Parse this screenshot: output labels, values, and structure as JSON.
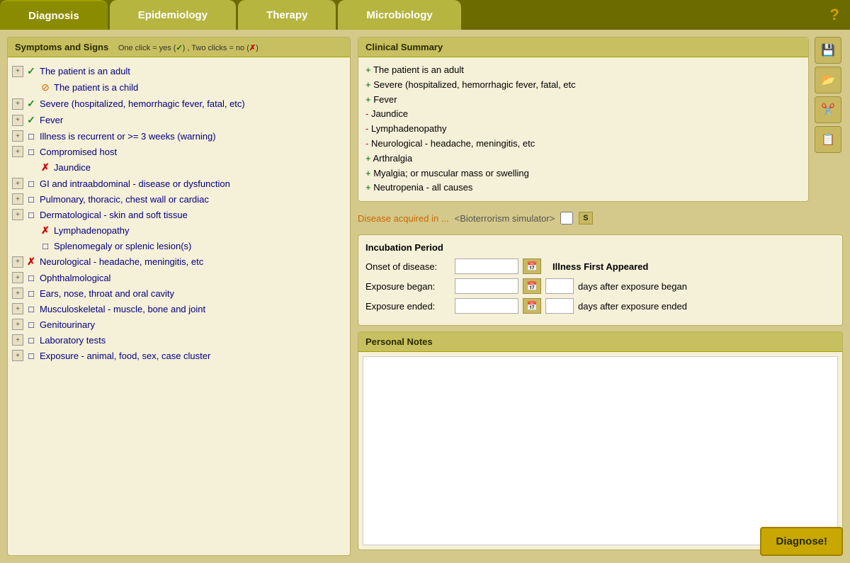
{
  "nav": {
    "tabs": [
      {
        "label": "Diagnosis",
        "active": true
      },
      {
        "label": "Epidemiology",
        "active": false
      },
      {
        "label": "Therapy",
        "active": false
      },
      {
        "label": "Microbiology",
        "active": false
      }
    ],
    "help_icon": "?"
  },
  "left_panel": {
    "header": "Symptoms and Signs",
    "click_hint": "One click = yes (✓) ,  Two clicks = no (✗)",
    "symptoms": [
      {
        "status": "check",
        "label": "The patient is an adult",
        "indent": 0,
        "expandable": true
      },
      {
        "status": "no",
        "label": "The patient is a child",
        "indent": 1,
        "expandable": false
      },
      {
        "status": "check",
        "label": "Severe (hospitalized, hemorrhagic fever, fatal, etc)",
        "indent": 0,
        "expandable": true
      },
      {
        "status": "check",
        "label": "Fever",
        "indent": 0,
        "expandable": true
      },
      {
        "status": "empty",
        "label": "Illness is recurrent or >= 3 weeks (warning)",
        "indent": 0,
        "expandable": true
      },
      {
        "status": "empty",
        "label": "Compromised host",
        "indent": 0,
        "expandable": true
      },
      {
        "status": "cross",
        "label": "Jaundice",
        "indent": 1,
        "expandable": false
      },
      {
        "status": "empty",
        "label": "GI and intraabdominal - disease or dysfunction",
        "indent": 0,
        "expandable": true
      },
      {
        "status": "empty",
        "label": "Pulmonary, thoracic, chest wall or cardiac",
        "indent": 0,
        "expandable": true
      },
      {
        "status": "empty",
        "label": "Dermatological - skin and soft tissue",
        "indent": 0,
        "expandable": true
      },
      {
        "status": "cross",
        "label": "Lymphadenopathy",
        "indent": 1,
        "expandable": false
      },
      {
        "status": "empty",
        "label": "Splenomegaly or splenic lesion(s)",
        "indent": 1,
        "expandable": false
      },
      {
        "status": "cross",
        "label": "Neurological - headache, meningitis, etc",
        "indent": 0,
        "expandable": true
      },
      {
        "status": "empty",
        "label": "Ophthalmological",
        "indent": 0,
        "expandable": true
      },
      {
        "status": "empty",
        "label": "Ears, nose, throat and oral cavity",
        "indent": 0,
        "expandable": true
      },
      {
        "status": "empty",
        "label": "Musculoskeletal - muscle, bone and joint",
        "indent": 0,
        "expandable": true
      },
      {
        "status": "empty",
        "label": "Genitourinary",
        "indent": 0,
        "expandable": true
      },
      {
        "status": "empty",
        "label": "Laboratory tests",
        "indent": 0,
        "expandable": true
      },
      {
        "status": "empty",
        "label": "Exposure - animal, food, sex, case cluster",
        "indent": 0,
        "expandable": true
      }
    ]
  },
  "clinical_summary": {
    "header": "Clinical Summary",
    "items": [
      {
        "sign": "+",
        "text": "The patient is an adult"
      },
      {
        "sign": "+",
        "text": "Severe (hospitalized, hemorrhagic fever, fatal, etc"
      },
      {
        "sign": "+",
        "text": "Fever"
      },
      {
        "sign": "-",
        "text": "Jaundice"
      },
      {
        "sign": "-",
        "text": "Lymphadenopathy"
      },
      {
        "sign": "-",
        "text": "Neurological - headache, meningitis, etc"
      },
      {
        "sign": "+",
        "text": "Arthralgia"
      },
      {
        "sign": "+",
        "text": "Myalgia; or muscular mass or swelling"
      },
      {
        "sign": "+",
        "text": "Neutropenia - all causes"
      }
    ]
  },
  "side_buttons": [
    {
      "icon": "💾",
      "name": "save-icon"
    },
    {
      "icon": "📂",
      "name": "open-icon"
    },
    {
      "icon": "✂️",
      "name": "cut-icon"
    },
    {
      "icon": "📋",
      "name": "paste-icon"
    }
  ],
  "disease_row": {
    "link_text": "Disease acquired in ...",
    "sim_text": "<Bioterrorism simulator>",
    "s_label": "S"
  },
  "incubation": {
    "title": "Incubation Period",
    "onset_label": "Onset of disease:",
    "exposure_began_label": "Exposure began:",
    "exposure_ended_label": "Exposure ended:",
    "illness_first_label": "Illness First Appeared",
    "days_after_began": "days after exposure began",
    "days_after_ended": "days after exposure ended"
  },
  "personal_notes": {
    "header": "Personal Notes"
  },
  "diagnose_button": "Diagnose!"
}
